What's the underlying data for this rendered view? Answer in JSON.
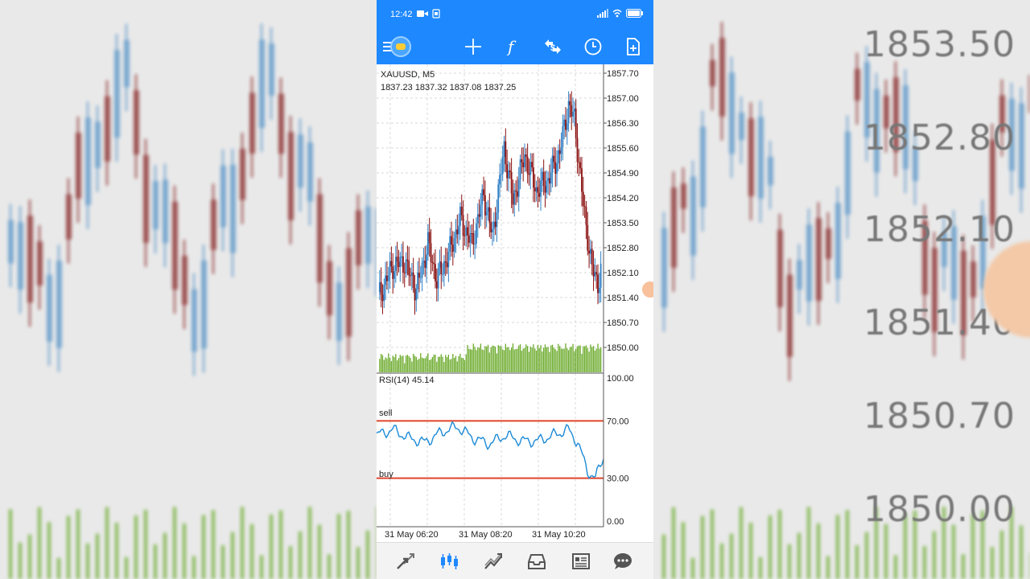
{
  "status_bar": {
    "time": "12:42"
  },
  "chart": {
    "symbol": "XAUUSD, M5",
    "ohlc": "1837.23 1837.32 1837.08 1837.25",
    "price_ticks": [
      "1857.70",
      "1857.00",
      "1856.30",
      "1855.60",
      "1854.90",
      "1854.20",
      "1853.50",
      "1852.80",
      "1852.10",
      "1851.40",
      "1850.70",
      "1850.00"
    ],
    "time_labels": [
      "31 May 06:20",
      "31 May 08:20",
      "31 May 10:20"
    ],
    "rsi_label": "RSI(14) 45.14",
    "rsi_ticks": [
      "100.00",
      "70.00",
      "30.00",
      "0.00"
    ],
    "sell_label": "sell",
    "buy_label": "buy",
    "colors": {
      "bull": "#2f7fc4",
      "bear": "#8b1010",
      "volume": "#6aaa2a",
      "rsi": "#1c8ad6",
      "level": "#e0442a",
      "accent": "#1e88ff"
    }
  },
  "background": {
    "price_labels": [
      "1853.50",
      "1852.80",
      "1852.10",
      "1851.40",
      "1850.70",
      "1850.00"
    ]
  },
  "toolbar": {
    "icons": [
      "menu-icon",
      "app-logo-icon",
      "crosshair-icon",
      "indicators-icon",
      "trade-icon",
      "period-icon",
      "add-object-icon"
    ]
  },
  "bottom_nav": {
    "icons": [
      "quotes-icon",
      "chart-icon",
      "trade-icon",
      "history-icon",
      "news-icon",
      "chat-icon"
    ]
  }
}
